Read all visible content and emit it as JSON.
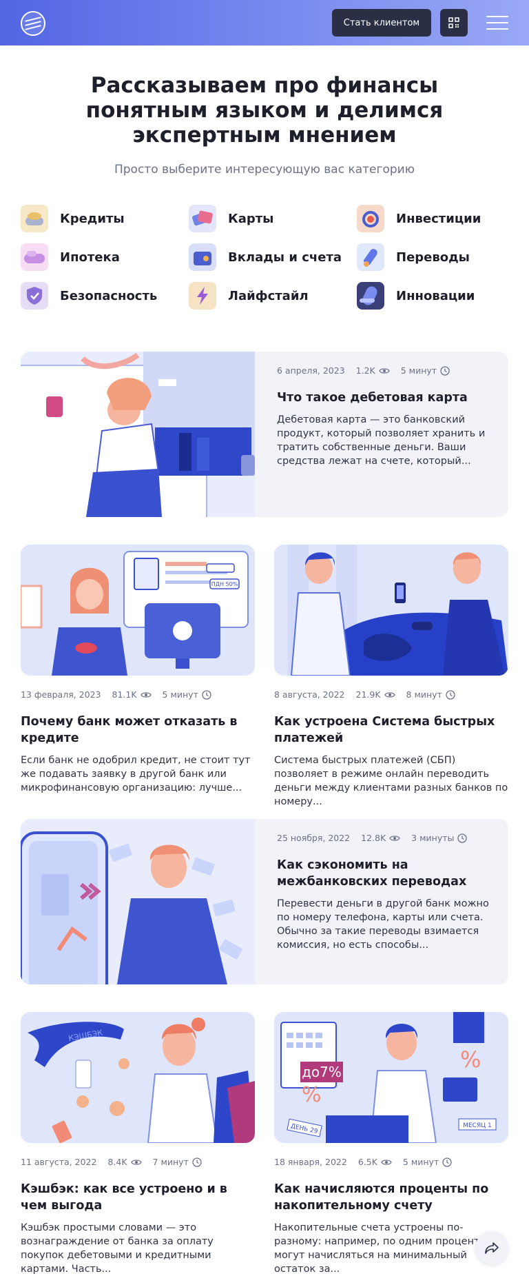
{
  "header": {
    "client_button": "Стать клиентом"
  },
  "hero": {
    "title": "Рассказываем про финансы понятным языком и делимся экспертным мнением",
    "subtitle": "Просто выберите интересующую вас категорию"
  },
  "categories": [
    {
      "label": "Кредиты",
      "icon": "credits-coins-icon"
    },
    {
      "label": "Карты",
      "icon": "cards-icon"
    },
    {
      "label": "Инвестиции",
      "icon": "investments-target-icon"
    },
    {
      "label": "Ипотека",
      "icon": "mortgage-icon"
    },
    {
      "label": "Вклады и счета",
      "icon": "deposits-wallet-icon"
    },
    {
      "label": "Переводы",
      "icon": "transfers-rocket-icon"
    },
    {
      "label": "Безопасность",
      "icon": "security-shield-icon"
    },
    {
      "label": "Лайфстайл",
      "icon": "lifestyle-lightning-icon"
    },
    {
      "label": "Инновации",
      "icon": "innovations-icon"
    }
  ],
  "articles": [
    {
      "date": "6 апреля, 2023",
      "views": "1.2K",
      "read_time": "5 минут",
      "title": "Что такое дебетовая карта",
      "excerpt": "Дебетовая карта — это банковский продукт, который позволяет хранить и тратить собственные деньги. Ваши средства лежат на счете, который..."
    },
    {
      "date": "13 февраля, 2023",
      "views": "81.1K",
      "read_time": "5 минут",
      "title": "Почему банк может отказать в кредите",
      "excerpt": "Если банк не одобрил кредит, не стоит тут же подавать заявку в другой банк или микрофинансовую организацию: лучше..."
    },
    {
      "date": "8 августа, 2022",
      "views": "21.9K",
      "read_time": "8 минут",
      "title": "Как устроена Система быстрых платежей",
      "excerpt": "Система быстрых платежей (СБП) позволяет в режиме онлайн переводить деньги между клиентами разных банков по номеру..."
    },
    {
      "date": "25 ноября, 2022",
      "views": "12.8K",
      "read_time": "3 минуты",
      "title": "Как сэкономить на межбанковских переводах",
      "excerpt": "Перевести деньги в другой банк можно по номеру телефона, карты или счета. Обычно за такие переводы взимается комиссия, но есть способы..."
    },
    {
      "date": "11 августа, 2022",
      "views": "8.4K",
      "read_time": "7 минут",
      "title": "Кэшбэк: как все устроено и в чем выгода",
      "excerpt": "Кэшбэк простыми словами — это вознаграждение от банка за оплату покупок дебетовыми и кредитными картами. Часть..."
    },
    {
      "date": "18 января, 2022",
      "views": "6.5K",
      "read_time": "5 минут",
      "title": "Как начисляются проценты по накопительному счету",
      "excerpt": "Накопительные счета устроены по-разному: например, по одним проценты могут начисляться на минимальный остаток за..."
    }
  ],
  "illustration_text": {
    "credit_badge": "ПДН 50%",
    "cashback_word": "КЭШБЭК",
    "percent_badge": "до7%",
    "day_tag": "ДЕНЬ 29",
    "month_tag": "МЕСЯЦ 1"
  },
  "colors": {
    "accent": "#5266e4",
    "dark_button": "#2b2f45",
    "card_bg": "#f1f3f8",
    "text_primary": "#1d1f2b",
    "text_muted": "#6b7087"
  }
}
